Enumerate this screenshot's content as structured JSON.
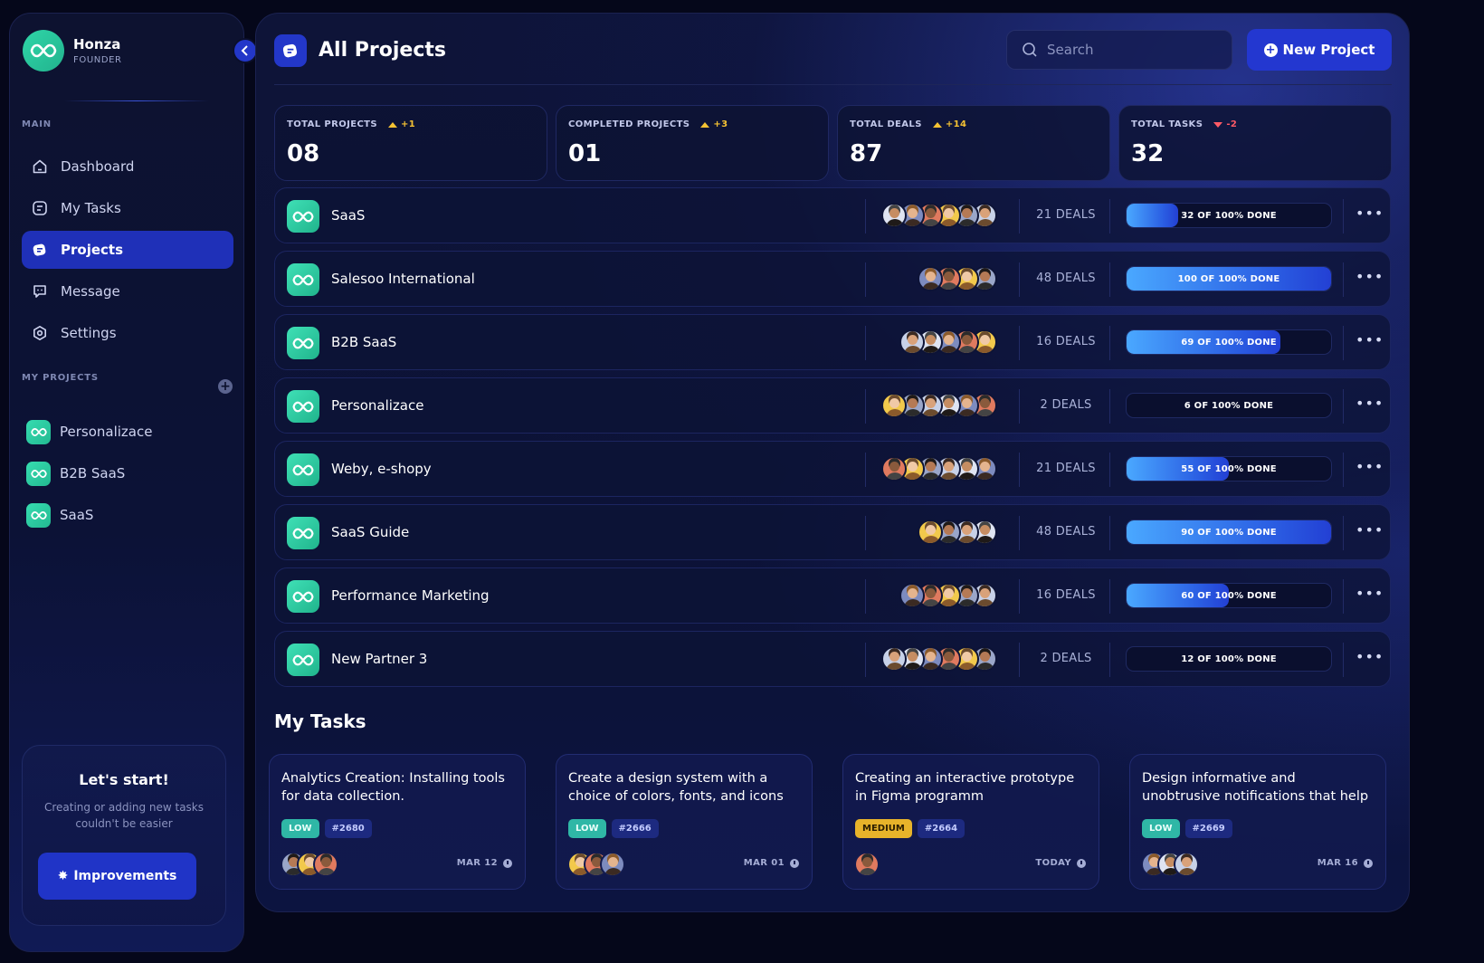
{
  "user": {
    "name": "Honza",
    "role": "FOUNDER"
  },
  "nav": {
    "section_label": "MAIN",
    "items": [
      {
        "label": "Dashboard",
        "icon": "home-icon",
        "active": false
      },
      {
        "label": "My Tasks",
        "icon": "tasks-icon",
        "active": false
      },
      {
        "label": "Projects",
        "icon": "projects-icon",
        "active": true
      },
      {
        "label": "Message",
        "icon": "message-icon",
        "active": false
      },
      {
        "label": "Settings",
        "icon": "settings-icon",
        "active": false
      }
    ]
  },
  "my_projects": {
    "section_label": "MY PROJECTS",
    "items": [
      {
        "label": "Personalizace"
      },
      {
        "label": "B2B SaaS"
      },
      {
        "label": "SaaS"
      }
    ]
  },
  "start_card": {
    "title": "Let's start!",
    "subtitle": "Creating or adding new tasks couldn't be easier",
    "button": "Improvements"
  },
  "header": {
    "title": "All Projects",
    "search_placeholder": "Search",
    "new_button": "New Project"
  },
  "stats": [
    {
      "label": "TOTAL PROJECTS",
      "delta": "+1",
      "trend": "up",
      "value": "08"
    },
    {
      "label": "COMPLETED PROJECTS",
      "delta": "+3",
      "trend": "up",
      "value": "01"
    },
    {
      "label": "TOTAL DEALS",
      "delta": "+14",
      "trend": "up",
      "value": "87"
    },
    {
      "label": "TOTAL TASKS",
      "delta": "-2",
      "trend": "down",
      "value": "32"
    }
  ],
  "projects": [
    {
      "name": "SaaS",
      "avatars": 6,
      "deals": "21 DEALS",
      "progress": 0.25,
      "progress_label": "32 OF 100% DONE"
    },
    {
      "name": "Salesoo International",
      "avatars": 4,
      "deals": "48 DEALS",
      "progress": 1.0,
      "progress_label": "100 OF 100% DONE"
    },
    {
      "name": "B2B SaaS",
      "avatars": 5,
      "deals": "16 DEALS",
      "progress": 0.75,
      "progress_label": "69 OF 100% DONE"
    },
    {
      "name": "Personalizace",
      "avatars": 6,
      "deals": "2 DEALS",
      "progress": 0.0,
      "progress_label": "6 OF 100% DONE"
    },
    {
      "name": "Weby, e-shopy",
      "avatars": 6,
      "deals": "21 DEALS",
      "progress": 0.5,
      "progress_label": "55 OF 100% DONE"
    },
    {
      "name": "SaaS Guide",
      "avatars": 4,
      "deals": "48 DEALS",
      "progress": 1.0,
      "progress_label": "90 OF 100% DONE"
    },
    {
      "name": "Performance Marketing",
      "avatars": 5,
      "deals": "16 DEALS",
      "progress": 0.5,
      "progress_label": "60 OF 100% DONE"
    },
    {
      "name": "New Partner 3",
      "avatars": 6,
      "deals": "2 DEALS",
      "progress": 0.0,
      "progress_label": "12 OF 100% DONE"
    }
  ],
  "tasks_title": "My Tasks",
  "tasks": [
    {
      "title": "Analytics Creation: Installing tools for data collection.",
      "priority": "LOW",
      "priority_level": "low",
      "id": "#2680",
      "date": "MAR 12",
      "avatars": 3
    },
    {
      "title": "Create a design system with a choice of colors, fonts, and icons",
      "priority": "LOW",
      "priority_level": "low",
      "id": "#2666",
      "date": "MAR 01",
      "avatars": 3
    },
    {
      "title": "Creating an interactive prototype in Figma programm",
      "priority": "MEDIUM",
      "priority_level": "medium",
      "id": "#2664",
      "date": "TODAY",
      "avatars": 1
    },
    {
      "title": "Design informative and unobtrusive notifications that help users withou...",
      "priority": "LOW",
      "priority_level": "low",
      "id": "#2669",
      "date": "MAR 16",
      "avatars": 3
    }
  ],
  "colors": {
    "accent": "#2337c9",
    "brand_green": "#2fd6a8",
    "trend_up": "#f5c233",
    "trend_down": "#ff5a66"
  }
}
